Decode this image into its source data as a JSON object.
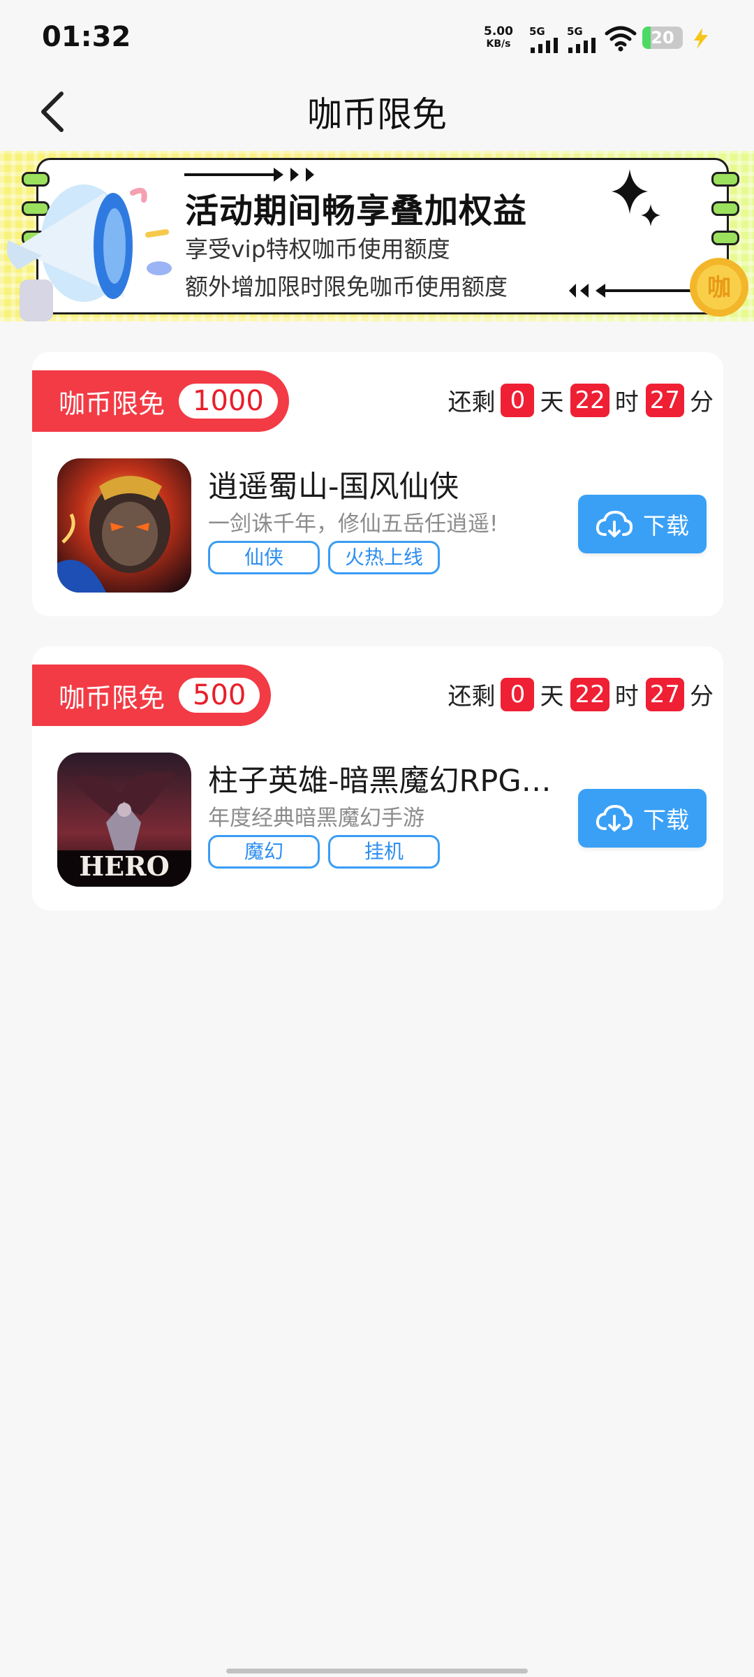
{
  "status_bar": {
    "time": "01:32",
    "net_speed_value": "5.00",
    "net_speed_unit": "KB/s",
    "signal1_label": "5G",
    "signal2_label": "5G",
    "battery_level": "20",
    "battery_fraction": 0.2,
    "icons": [
      "signal-icon",
      "wifi-icon",
      "battery-icon",
      "charging-bolt-icon"
    ]
  },
  "header": {
    "title": "咖币限免",
    "back_icon": "chevron-left-icon"
  },
  "banner": {
    "title": "活动期间畅享叠加权益",
    "line1": "享受vip特权咖币使用额度",
    "line2": "额外增加限时限免咖币使用额度",
    "colors": {
      "bg": "#f8f27a",
      "notch": "#9be15d"
    }
  },
  "cards": [
    {
      "tag_label": "咖币限免",
      "amount": "1000",
      "countdown": {
        "prefix": "还剩",
        "days": "0",
        "days_unit": "天",
        "hours": "22",
        "hours_unit": "时",
        "minutes": "27",
        "minutes_unit": "分"
      },
      "app_name": "逍遥蜀山-国风仙侠",
      "app_desc": "一剑诛千年，修仙五岳任逍遥!",
      "chips": [
        "仙侠",
        "火热上线"
      ],
      "download_label": "下载"
    },
    {
      "tag_label": "咖币限免",
      "amount": "500",
      "countdown": {
        "prefix": "还剩",
        "days": "0",
        "days_unit": "天",
        "hours": "22",
        "hours_unit": "时",
        "minutes": "27",
        "minutes_unit": "分"
      },
      "app_name": "柱子英雄-暗黑魔幻RPG…",
      "app_desc": "年度经典暗黑魔幻手游",
      "app_icon_text": "HERO",
      "chips": [
        "魔幻",
        "挂机"
      ],
      "download_label": "下载"
    }
  ],
  "colors": {
    "accent_red": "#f23b45",
    "accent_blue": "#3aa0f6",
    "page_bg": "#f7f7f7"
  }
}
